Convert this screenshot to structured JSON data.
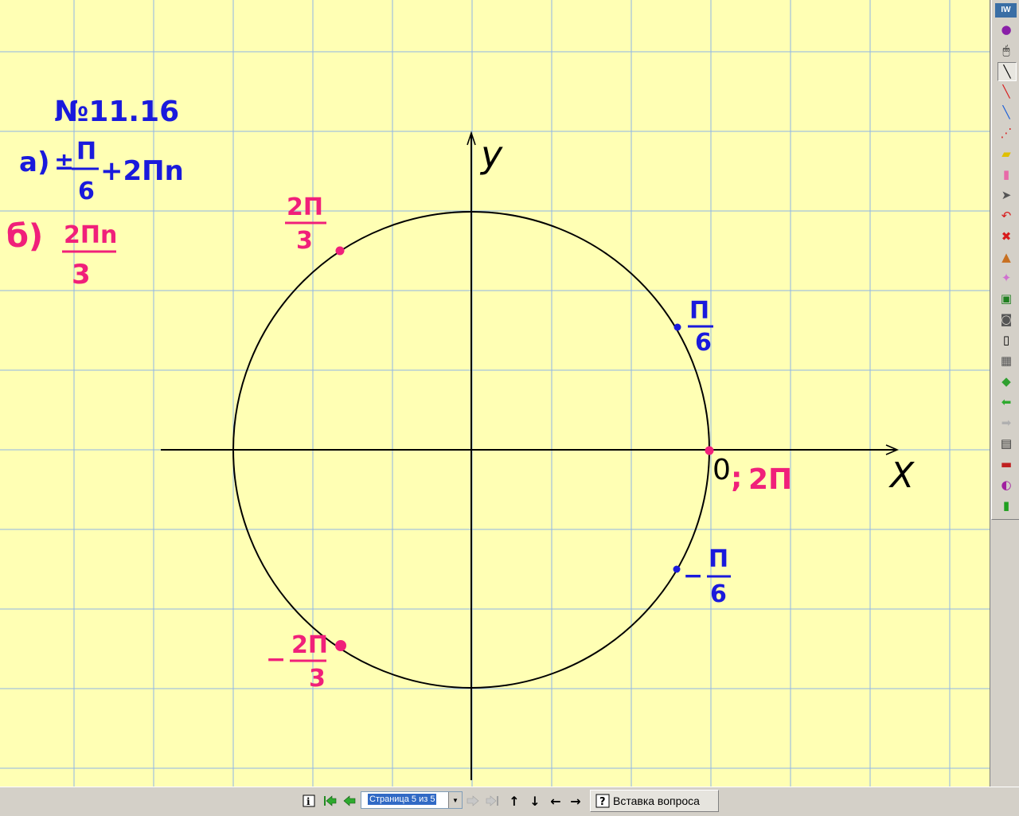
{
  "app": {
    "logo": "IW"
  },
  "board": {
    "title": "№11.16",
    "line_a": {
      "label": "а)",
      "sign": "±",
      "num": "П",
      "den": "6",
      "tail": "+2Пn"
    },
    "line_b": {
      "label": "б)",
      "num": "2Пn",
      "den": "3"
    },
    "axis_x": "X",
    "axis_y": "y",
    "points": {
      "pi6": {
        "num": "П",
        "den": "6"
      },
      "neg_pi6": {
        "sign": "−",
        "num": "П",
        "den": "6"
      },
      "two_pi3": {
        "num": "2П",
        "den": "3"
      },
      "neg_two_pi3": {
        "sign": "−",
        "num": "2П",
        "den": "3"
      },
      "zero": "0",
      "sep": ";",
      "two_pi": "2П"
    },
    "colors": {
      "background": "#ffffb4",
      "grid": "#8fb6e6",
      "blue_ink": "#1a1adc",
      "pink_ink": "#f0207a",
      "black_ink": "#000000"
    }
  },
  "toolbar": {
    "tools": [
      "pen-icon",
      "mouse-icon",
      "line-tool-icon",
      "red-pen-icon",
      "colored-pen-icon",
      "dotted-pen-icon",
      "highlighter-icon",
      "eraser-icon",
      "select-arrow-icon",
      "undo-icon",
      "clear-icon",
      "stamp-icon",
      "magic-wand-icon",
      "screen-capture-icon",
      "camera-icon",
      "blank-page-icon",
      "grid-page-icon",
      "colorful-page-icon",
      "prev-page-icon",
      "next-page-icon",
      "page-sorter-icon",
      "toolbox-icon",
      "help-icon",
      "exit-icon"
    ]
  },
  "status": {
    "page_selector": "Страница 5 из 5",
    "insert_question": "Вставка вопроса"
  }
}
